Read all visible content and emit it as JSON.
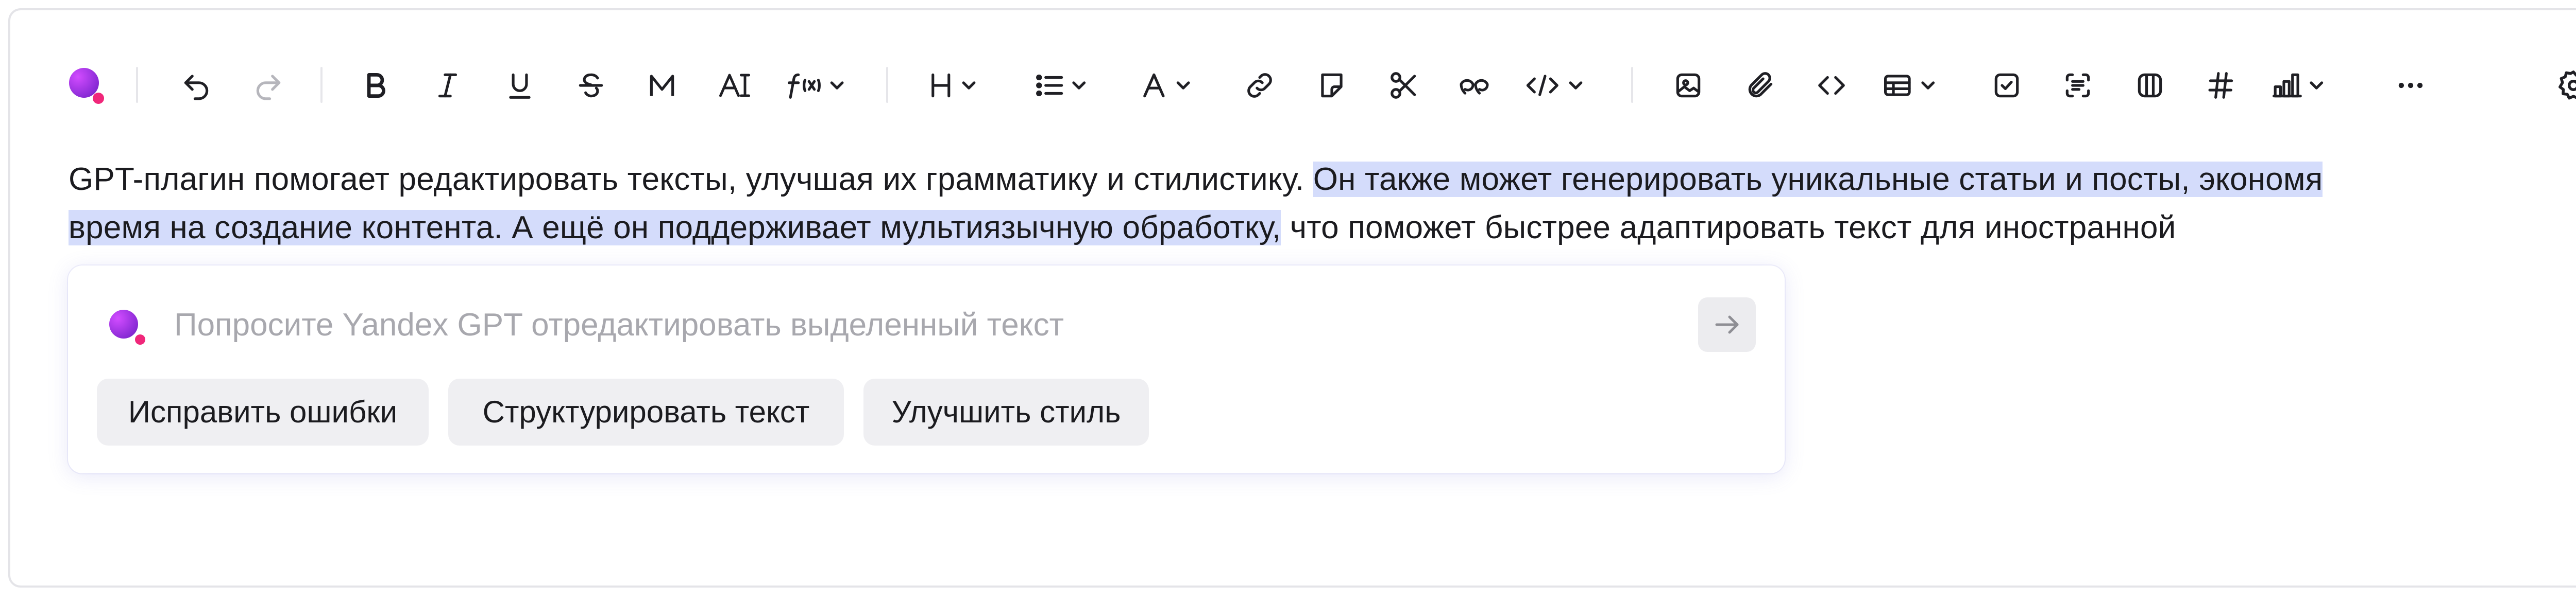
{
  "editor": {
    "line1_plain": "GPT-плагин помогает редактировать тексты, улучшая их грамматику и стилистику. ",
    "line1_selected": "Он также может генерировать уникальные статьи и посты, экономя",
    "line2_selected": "время на создание контента. А ещё он поддерживает мультиязычную обработку,",
    "line2_plain": " что поможет быстрее адаптировать текст для иностранной"
  },
  "toolbar": {
    "icons": [
      "yandex-gpt-icon",
      "undo-icon",
      "redo-icon",
      "bold-icon",
      "italic-icon",
      "underline-icon",
      "strikethrough-icon",
      "monospace-icon",
      "text-size-icon",
      "formula-icon",
      "heading-icon",
      "list-icon",
      "text-color-icon",
      "link-icon",
      "note-icon",
      "cut-icon",
      "quote-icon",
      "code-block-icon",
      "image-icon",
      "attachment-icon",
      "code-icon",
      "table-icon",
      "checkbox-icon",
      "transcript-icon",
      "columns-icon",
      "hashtag-icon",
      "chart-icon",
      "more-icon",
      "settings-icon"
    ]
  },
  "gpt_popup": {
    "placeholder": "Попросите Yandex GPT отредактировать выделенный текст",
    "suggestions": [
      "Исправить ошибки",
      "Структурировать текст",
      "Улучшить стиль"
    ]
  },
  "colors": {
    "selection": "#d4dcfb",
    "gpt_accent": "#8a2bd6",
    "gpt_dot": "#f0277a"
  }
}
